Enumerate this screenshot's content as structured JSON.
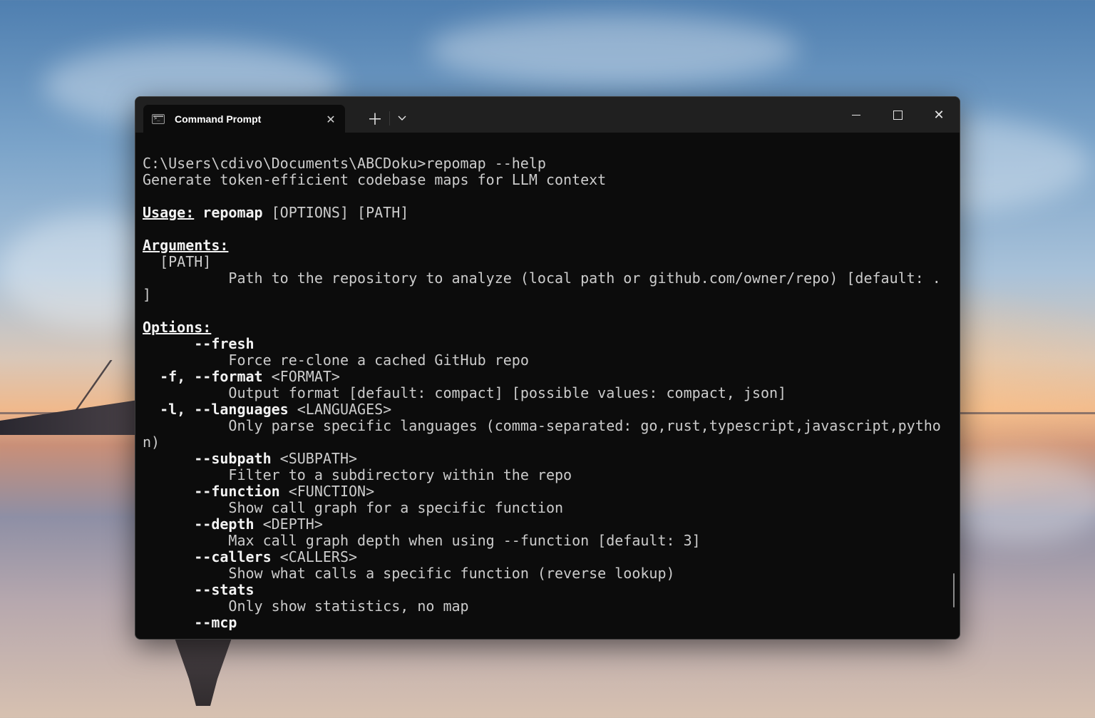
{
  "window": {
    "tab_title": "Command Prompt",
    "icons": {
      "tab": "terminal-icon",
      "close_tab": "close-icon",
      "new_tab": "plus-icon",
      "dropdown": "chevron-down-icon",
      "minimize": "minimize-icon",
      "maximize": "maximize-icon",
      "close": "close-icon"
    }
  },
  "terminal": {
    "prompt": "C:\\Users\\cdivo\\Documents\\ABCDoku>",
    "command": "repomap --help",
    "description": "Generate token-efficient codebase maps for LLM context",
    "usage_label": "Usage:",
    "usage_cmd": "repomap",
    "usage_args": "[OPTIONS] [PATH]",
    "arguments_label": "Arguments:",
    "arguments": [
      {
        "name": "[PATH]",
        "desc": "Path to the repository to analyze (local path or github.com/owner/repo) [default: .",
        "wrap": "]"
      }
    ],
    "options_label": "Options:",
    "options": [
      {
        "flag": "      --fresh",
        "arg": "",
        "desc": "Force re-clone a cached GitHub repo",
        "wrap": ""
      },
      {
        "flag": "  -f, --format",
        "arg": " <FORMAT>",
        "desc": "Output format [default: compact] [possible values: compact, json]",
        "wrap": ""
      },
      {
        "flag": "  -l, --languages",
        "arg": " <LANGUAGES>",
        "desc": "Only parse specific languages (comma-separated: go,rust,typescript,javascript,pytho",
        "wrap": "n)"
      },
      {
        "flag": "      --subpath",
        "arg": " <SUBPATH>",
        "desc": "Filter to a subdirectory within the repo",
        "wrap": ""
      },
      {
        "flag": "      --function",
        "arg": " <FUNCTION>",
        "desc": "Show call graph for a specific function",
        "wrap": ""
      },
      {
        "flag": "      --depth",
        "arg": " <DEPTH>",
        "desc": "Max call graph depth when using --function [default: 3]",
        "wrap": ""
      },
      {
        "flag": "      --callers",
        "arg": " <CALLERS>",
        "desc": "Show what calls a specific function (reverse lookup)",
        "wrap": ""
      },
      {
        "flag": "      --stats",
        "arg": "",
        "desc": "Only show statistics, no map",
        "wrap": ""
      },
      {
        "flag": "      --mcp",
        "arg": "",
        "desc": "",
        "wrap": ""
      }
    ]
  }
}
